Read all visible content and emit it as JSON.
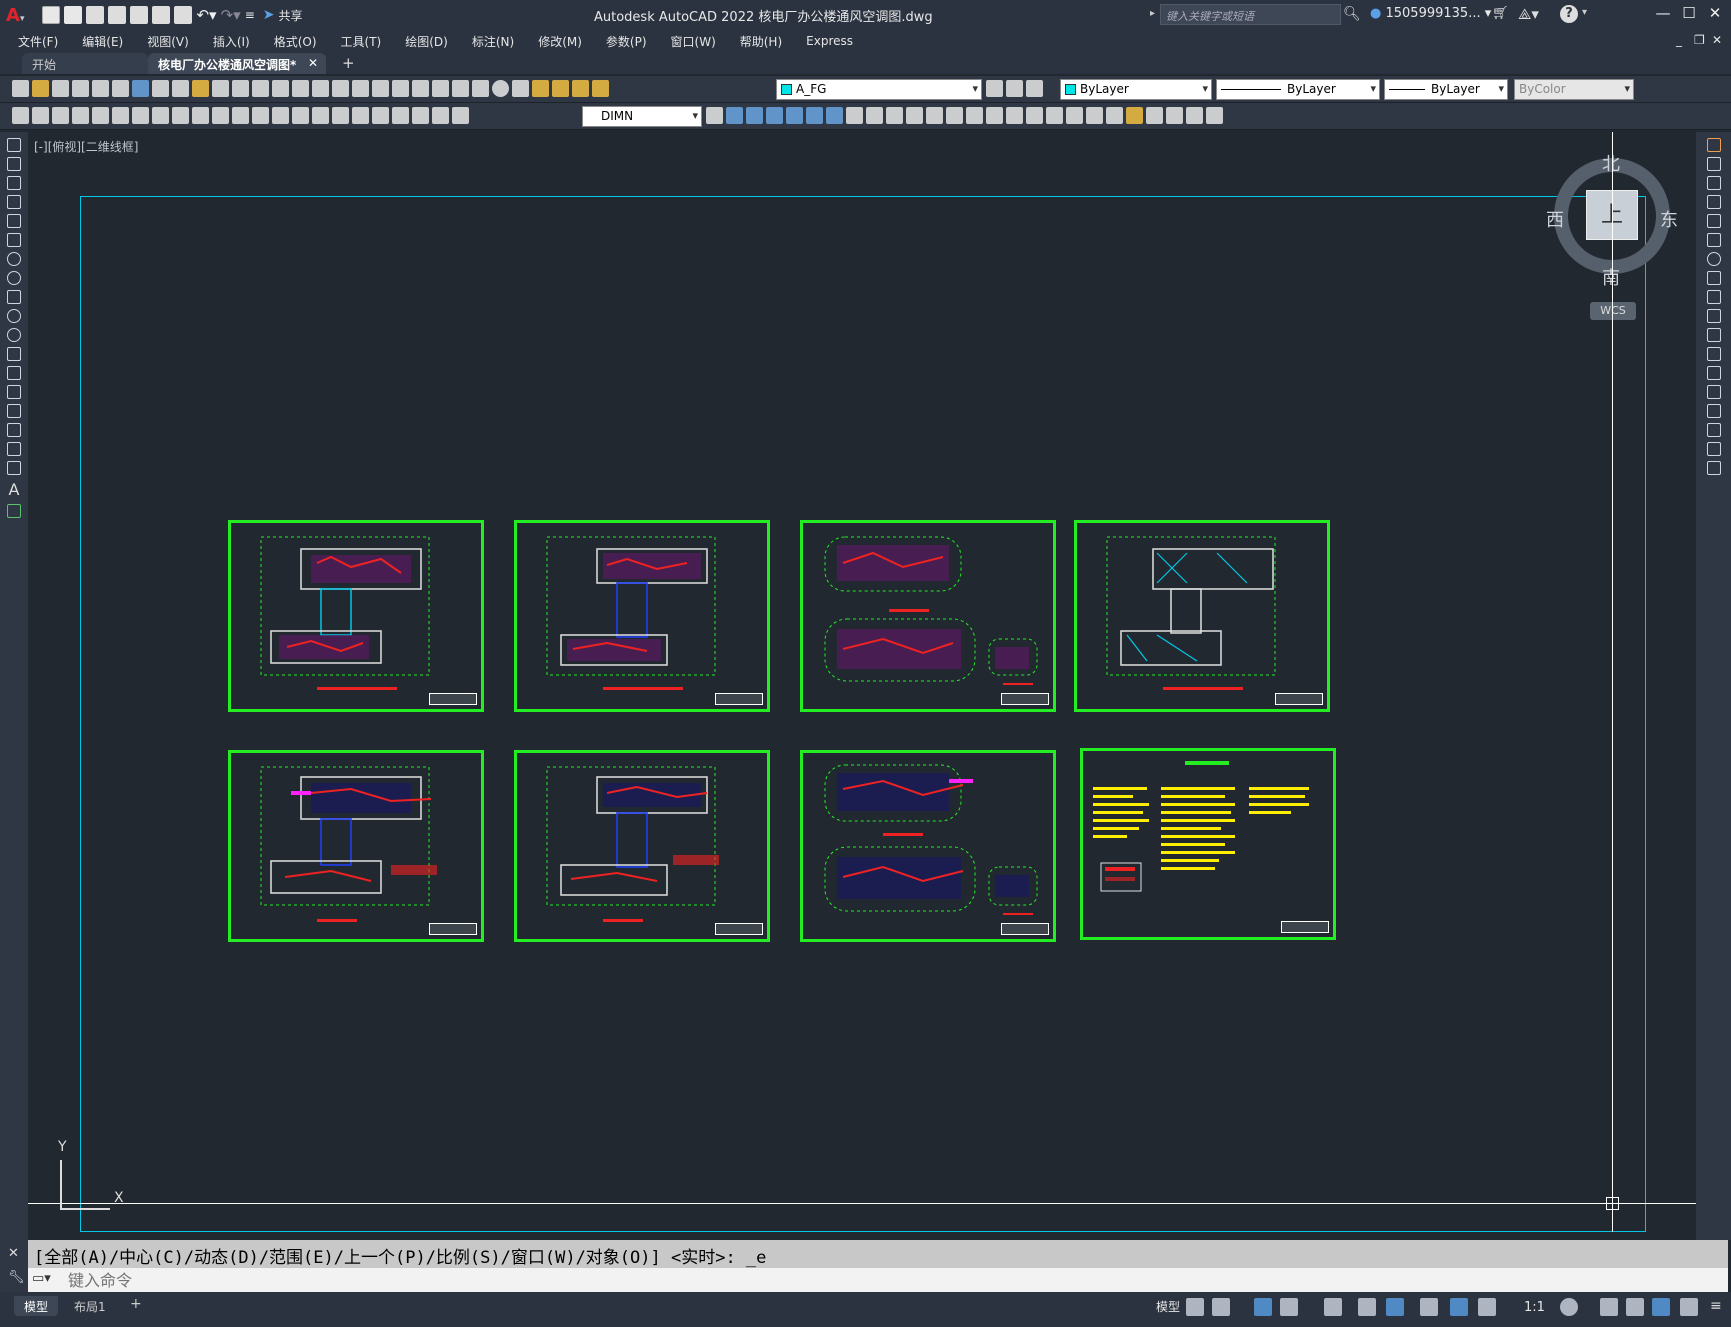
{
  "window": {
    "app_title": "Autodesk AutoCAD 2022    核电厂办公楼通风空调图.dwg",
    "share_label": "共享",
    "search_placeholder": "键入关键字或短语",
    "user_name": "1505999135...",
    "help_label": "?"
  },
  "menu": [
    "文件(F)",
    "编辑(E)",
    "视图(V)",
    "插入(I)",
    "格式(O)",
    "工具(T)",
    "绘图(D)",
    "标注(N)",
    "修改(M)",
    "参数(P)",
    "窗口(W)",
    "帮助(H)",
    "Express"
  ],
  "tabs": {
    "start_label": "开始",
    "file_tab_label": "核电厂办公楼通风空调图*",
    "add_label": "+"
  },
  "properties": {
    "layer": "A_FG",
    "color": "ByLayer",
    "linetype": "ByLayer",
    "lineweight": "ByLayer",
    "plotstyle": "ByColor",
    "dimstyle": "DIMN"
  },
  "viewport": {
    "label": "[-][俯视][二维线框]"
  },
  "viewcube": {
    "north": "北",
    "south": "南",
    "east": "东",
    "west": "西",
    "top_face": "上",
    "wcs_label": "WCS"
  },
  "ucs": {
    "x_label": "X",
    "y_label": "Y"
  },
  "command": {
    "history": "[全部(A)/中心(C)/动态(D)/范围(E)/上一个(P)/比例(S)/窗口(W)/对象(O)] <实时>: _e",
    "placeholder": "键入命令"
  },
  "status": {
    "model_tab": "模型",
    "layout_tab": "布局1",
    "add_layout": "+",
    "model_space": "模型",
    "scale": "1:1"
  },
  "colors": {
    "sheet_border": "#22ee22",
    "model_border": "#00c8e6",
    "background": "#212830"
  }
}
